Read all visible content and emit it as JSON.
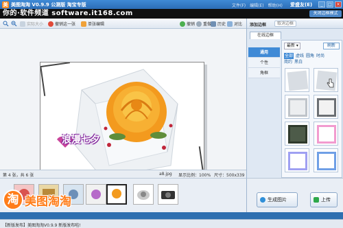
{
  "titlebar": {
    "logo_char": "美",
    "title": "美图淘淘 V0.9.9 公测版 淘宝专版",
    "menu": [
      "文件(F)",
      "编辑(E)",
      "帮助(H)"
    ],
    "login_label": "爱盛友(E)",
    "window_buttons": [
      "_",
      "□",
      "×"
    ]
  },
  "watermark": {
    "text": "你的·软件频道 software.it168.com",
    "mode_button": "关闭边框模式"
  },
  "toolbar": {
    "zoom_in": "",
    "zoom_out": "",
    "actual_size": "实际大小",
    "undo": "撤销这一张",
    "batch_edit": "单张编辑",
    "revert": "撤销",
    "reset": "重做",
    "history": "历史",
    "compare": "对比"
  },
  "canvas": {
    "photo_text": "浪漫七夕"
  },
  "statusbar": {
    "page": "第 4 张，共 6 张",
    "filename": "a8.jpg",
    "ratio": "显示比例：100%",
    "size": "尺寸：500x339"
  },
  "brand": {
    "mark": "淘",
    "name": "美图淘淘"
  },
  "right_panel": {
    "title": "添加边框",
    "cancel_button": "取消边框",
    "tab": "在线边框",
    "categories": [
      "通用",
      "个性",
      "角框"
    ],
    "sort": "最新",
    "refresh": "刷新",
    "filters_row1": [
      "全部",
      "虚线",
      "圆角",
      "时尚"
    ],
    "filters_row2": [
      "简约",
      "黑白"
    ],
    "frame_colors": [
      "#d8dde3",
      "#d8dde3",
      "#bfc4ca",
      "#6b6f73",
      "#4d5b49",
      "#f29bcf",
      "#9fa0f2",
      "#6f9fe6"
    ]
  },
  "actions": {
    "generate": "生成图片",
    "upload": "上传"
  },
  "footer": {
    "left": "【新版发布】美图淘淘V0.9.9 新版发布啦!",
    "right": ""
  },
  "colors": {
    "accent": "#3f8ad6",
    "brand_orange": "#ff7d1a"
  }
}
